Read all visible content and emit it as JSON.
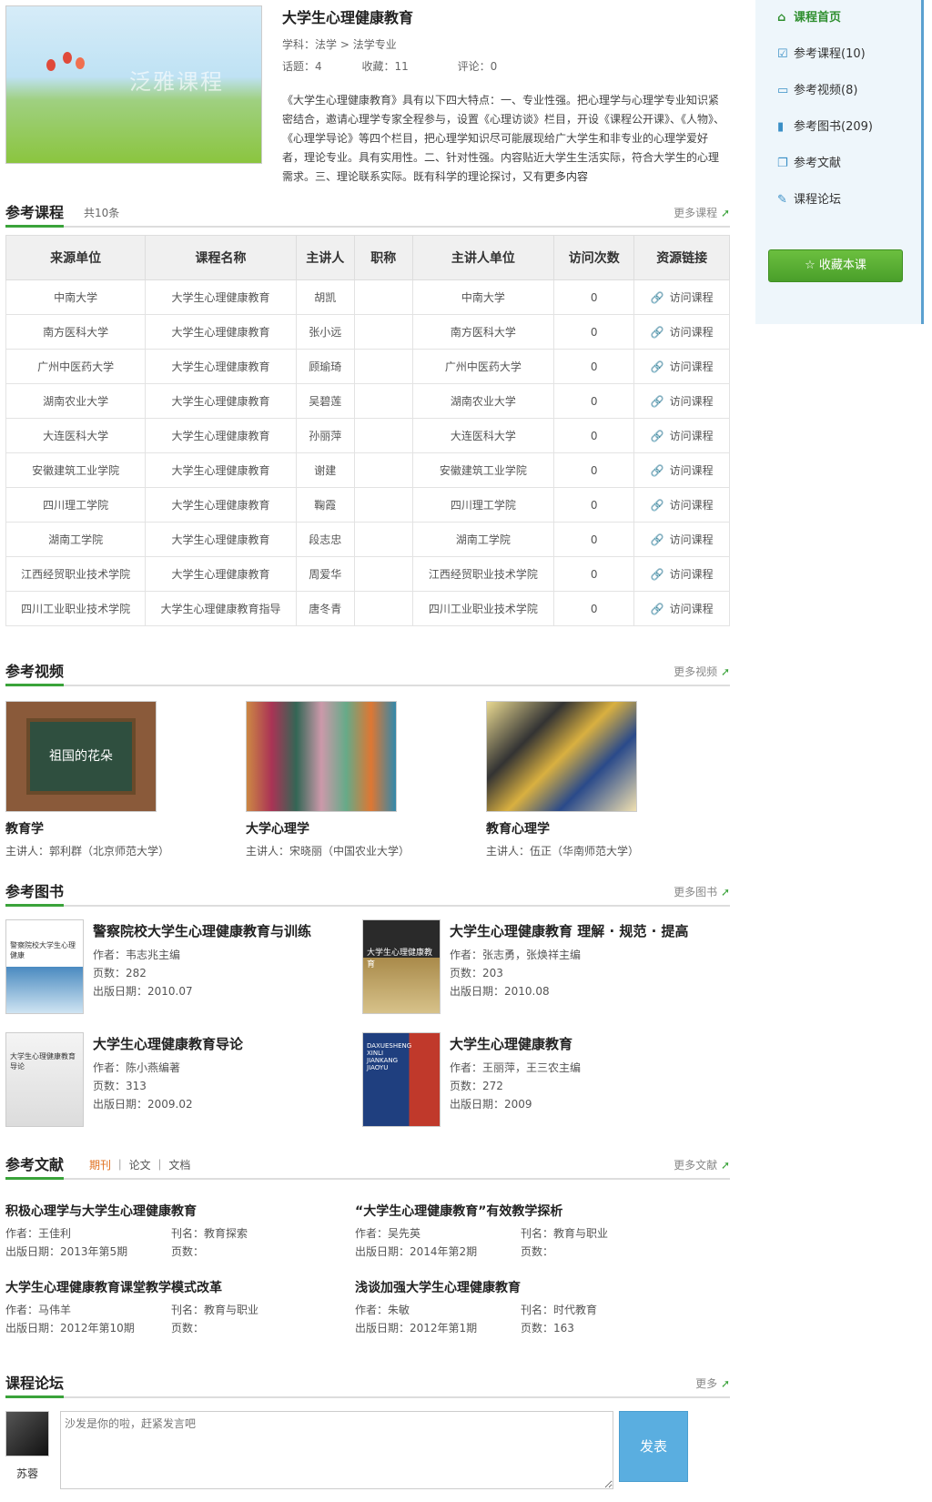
{
  "course": {
    "title": "大学生心理健康教育",
    "cover_logo_main": "泛雅",
    "cover_logo_sub": "课程",
    "subject_label": "学科：",
    "subject_value": "法学 > 法学专业",
    "topics_label": "话题：",
    "topics_value": "4",
    "fav_label": "收藏：",
    "fav_value": "11",
    "comments_label": "评论：",
    "comments_value": "0",
    "description": "《大学生心理健康教育》具有以下四大特点：一、专业性强。把心理学与心理学专业知识紧密结合，邀请心理学专家全程参与，设置《心理访谈》栏目，开设《课程公开课》、《人物》、《心理学导论》等四个栏目，把心理学知识尽可能展现给广大学生和非专业的心理学爱好者，理论专业。具有实用性。二、针对性强。内容贴近大学生生活实际，符合大学生的心理需求。三、理论联系实际。既有科学的理论探讨，又有",
    "description_more": "更多内容"
  },
  "ref_courses": {
    "title": "参考课程",
    "count": "共10条",
    "more": "更多课程",
    "columns": [
      "来源单位",
      "课程名称",
      "主讲人",
      "职称",
      "主讲人单位",
      "访问次数",
      "资源链接"
    ],
    "link_label": "访问课程",
    "rows": [
      [
        "中南大学",
        "大学生心理健康教育",
        "胡凯",
        "",
        "中南大学",
        "0"
      ],
      [
        "南方医科大学",
        "大学生心理健康教育",
        "张小远",
        "",
        "南方医科大学",
        "0"
      ],
      [
        "广州中医药大学",
        "大学生心理健康教育",
        "顾瑜琦",
        "",
        "广州中医药大学",
        "0"
      ],
      [
        "湖南农业大学",
        "大学生心理健康教育",
        "吴碧莲",
        "",
        "湖南农业大学",
        "0"
      ],
      [
        "大连医科大学",
        "大学生心理健康教育",
        "孙丽萍",
        "",
        "大连医科大学",
        "0"
      ],
      [
        "安徽建筑工业学院",
        "大学生心理健康教育",
        "谢建",
        "",
        "安徽建筑工业学院",
        "0"
      ],
      [
        "四川理工学院",
        "大学生心理健康教育",
        "鞠霞",
        "",
        "四川理工学院",
        "0"
      ],
      [
        "湖南工学院",
        "大学生心理健康教育",
        "段志忠",
        "",
        "湖南工学院",
        "0"
      ],
      [
        "江西经贸职业技术学院",
        "大学生心理健康教育",
        "周爱华",
        "",
        "江西经贸职业技术学院",
        "0"
      ],
      [
        "四川工业职业技术学院",
        "大学生心理健康教育指导",
        "唐冬青",
        "",
        "四川工业职业技术学院",
        "0"
      ]
    ]
  },
  "ref_videos": {
    "title": "参考视频",
    "more": "更多视频",
    "items": [
      {
        "title": "教育学",
        "host": "主讲人：郭利群（北京师范大学）",
        "thumb_text": "祖国的花朵"
      },
      {
        "title": "大学心理学",
        "host": "主讲人：宋晓丽（中国农业大学）"
      },
      {
        "title": "教育心理学",
        "host": "主讲人：伍正（华南师范大学）"
      }
    ]
  },
  "ref_books": {
    "title": "参考图书",
    "more": "更多图书",
    "items": [
      {
        "title": "警察院校大学生心理健康教育与训练",
        "author": "作者：韦志兆主编",
        "pages": "页数：282",
        "date": "出版日期：2010.07",
        "thumb_text": "警察院校大学生心理健康"
      },
      {
        "title": "大学生心理健康教育 理解 · 规范 · 提高",
        "author": "作者：张志勇，张焕祥主编",
        "pages": "页数：203",
        "date": "出版日期：2010.08",
        "thumb_text": "大学生心理健康教育"
      },
      {
        "title": "大学生心理健康教育导论",
        "author": "作者：陈小燕编著",
        "pages": "页数：313",
        "date": "出版日期：2009.02",
        "thumb_text": "大学生心理健康教育导论"
      },
      {
        "title": "大学生心理健康教育",
        "author": "作者：王丽萍，王三农主编",
        "pages": "页数：272",
        "date": "出版日期：2009",
        "thumb_text": "DAXUESHENG XINLI JIANKANG JIAOYU"
      }
    ]
  },
  "ref_docs": {
    "title": "参考文献",
    "tabs": [
      "期刊",
      "论文",
      "文档"
    ],
    "more": "更多文献",
    "items": [
      {
        "title": "积极心理学与大学生心理健康教育",
        "author": "作者：王佳利",
        "journal": "刊名：教育探索",
        "date": "出版日期：2013年第5期",
        "pages": "页数："
      },
      {
        "title": "“大学生心理健康教育”有效教学探析",
        "author": "作者：吴先英",
        "journal": "刊名：教育与职业",
        "date": "出版日期：2014年第2期",
        "pages": "页数："
      },
      {
        "title": "大学生心理健康教育课堂教学模式改革",
        "author": "作者：马伟羊",
        "journal": "刊名：教育与职业",
        "date": "出版日期：2012年第10期",
        "pages": "页数："
      },
      {
        "title": "浅谈加强大学生心理健康教育",
        "author": "作者：朱敏",
        "journal": "刊名：时代教育",
        "date": "出版日期：2012年第1期",
        "pages": "页数：163"
      }
    ]
  },
  "forum": {
    "title": "课程论坛",
    "more": "更多",
    "user_name": "苏蓉",
    "placeholder": "沙发是你的啦，赶紧发言吧",
    "post_label": "发表"
  },
  "side_nav": {
    "items": [
      {
        "label": "课程首页",
        "icon": "home-icon"
      },
      {
        "label": "参考课程(10)",
        "icon": "checklist-icon"
      },
      {
        "label": "参考视频(8)",
        "icon": "monitor-icon"
      },
      {
        "label": "参考图书(209)",
        "icon": "book-icon"
      },
      {
        "label": "参考文献",
        "icon": "document-icon"
      },
      {
        "label": "课程论坛",
        "icon": "chat-icon"
      }
    ],
    "fav_button": "收藏本课"
  }
}
